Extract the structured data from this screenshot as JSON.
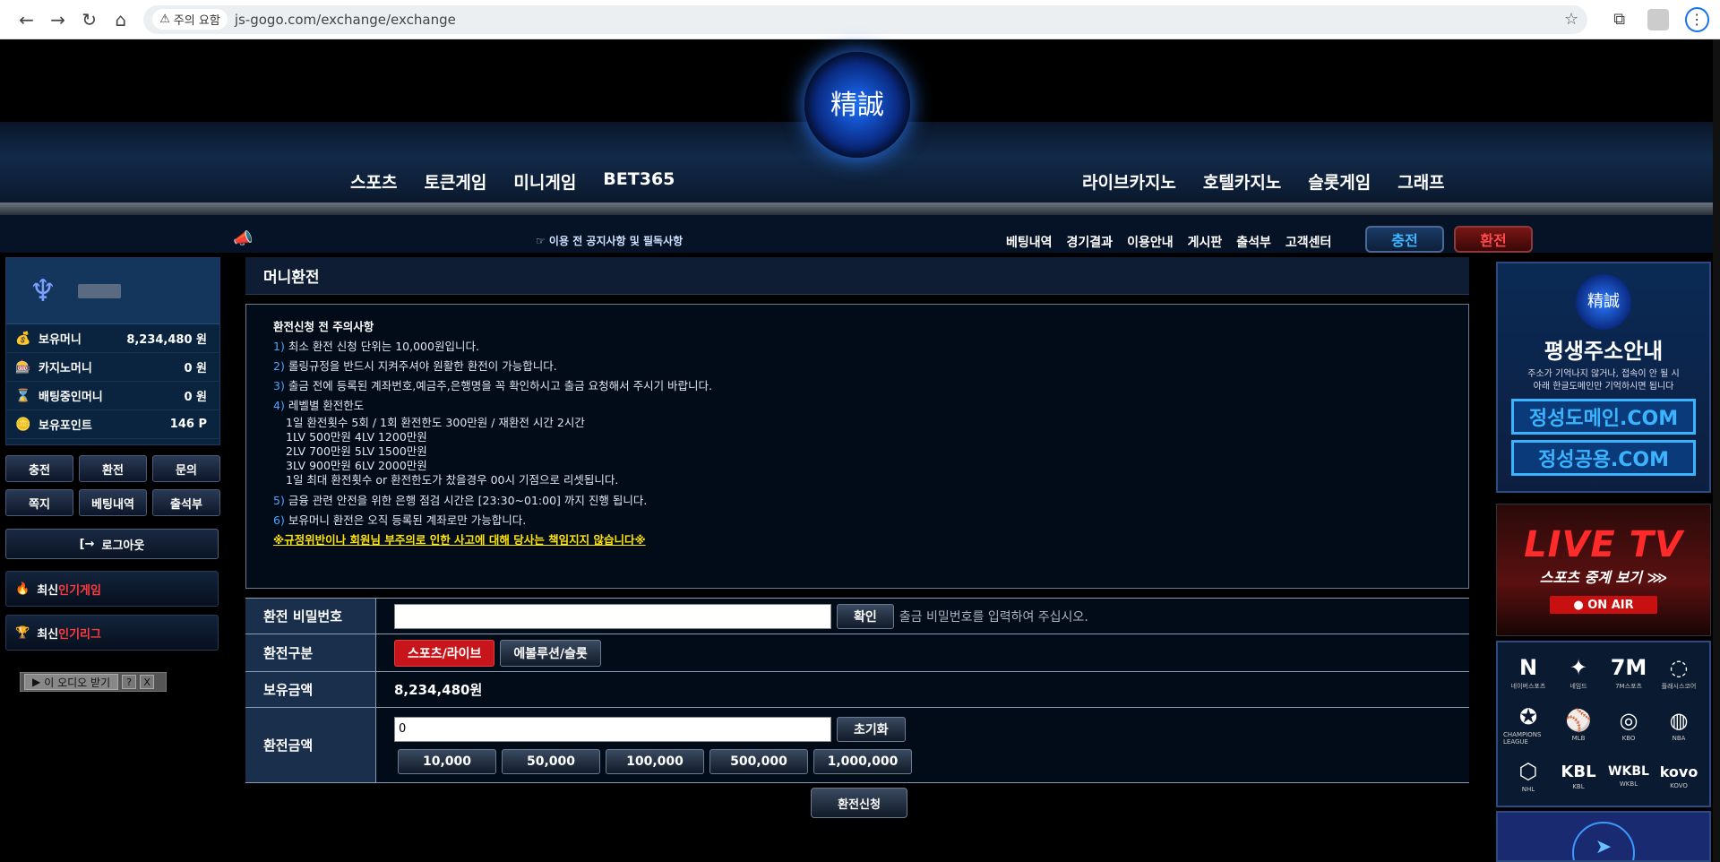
{
  "browser": {
    "warning": "주의 요함",
    "url": "js-gogo.com/exchange/exchange"
  },
  "header": {
    "logo_text": "精誠",
    "menu_left": [
      "스포츠",
      "토큰게임",
      "미니게임",
      "BET365"
    ],
    "menu_right": [
      "라이브카지노",
      "호텔카지노",
      "슬롯게임",
      "그래프"
    ],
    "notice": "☞ 이용 전 공지사항 및 필독사항",
    "top_nav": [
      "베팅내역",
      "경기결과",
      "이용안내",
      "게시판",
      "출석부",
      "고객센터"
    ],
    "charge_label": "충전",
    "exchange_label": "환전"
  },
  "user": {
    "rows": [
      {
        "label": "보유머니",
        "value": "8,234,480 원",
        "icon": "money-bag-icon"
      },
      {
        "label": "카지노머니",
        "value": "0 원",
        "icon": "chip-icon"
      },
      {
        "label": "배팅중인머니",
        "value": "0 원",
        "icon": "hourglass-icon"
      },
      {
        "label": "보유포인트",
        "value": "146 P",
        "icon": "coin-icon"
      }
    ],
    "buttons": [
      "충전",
      "환전",
      "문의",
      "쪽지",
      "베팅내역",
      "출석부"
    ],
    "logout": "로그아웃",
    "tab1": {
      "white": "최신",
      "red": "인기게임"
    },
    "tab2": {
      "white": "최신",
      "red": "인기리그"
    },
    "audio": "이 오디오 받기",
    "audio_help": "?",
    "audio_close": "X"
  },
  "main": {
    "title": "머니환전",
    "notice_head": "환전신청 전 주의사항",
    "items": [
      {
        "n": "1)",
        "text": "최소 환전 신청 단위는 10,000원입니다."
      },
      {
        "n": "2)",
        "text": "롤링규정을 반드시 지켜주셔야 원활한 환전이 가능합니다."
      },
      {
        "n": "3)",
        "text": "출금 전에 등록된 계좌번호,예금주,은행명을 꼭 확인하시고 출금 요청해서 주시기 바랍니다."
      },
      {
        "n": "4)",
        "text": "레벨별 환전한도"
      }
    ],
    "level_lines": [
      "1일 환전횟수 5회 / 1회 환전한도 300만원 / 재환전 시간 2시간",
      "1LV 500만원 4LV 1200만원",
      "2LV 700만원 5LV 1500만원",
      "3LV 900만원 6LV 2000만원",
      "1일 최대 환전횟수 or 환전한도가 찼을경우 00시 기점으로 리셋됩니다."
    ],
    "items2": [
      {
        "n": "5)",
        "text": "금융 관련 안전을 위한 은행 점검 시간은 [23:30~01:00] 까지 진행 됩니다."
      },
      {
        "n": "6)",
        "text": "보유머니 환전은 오직 등록된 계좌로만 가능합니다."
      }
    ],
    "warning": "※규정위반이나 회원님 부주의로 인한 사고에 대해 당사는 책임지지 않습니다※"
  },
  "form": {
    "pw_label": "환전 비밀번호",
    "pw_value": "",
    "confirm": "확인",
    "pw_hint": "출금 비밀번호를 입력하여 주십시오.",
    "type_label": "환전구분",
    "type_on": "스포츠/라이브",
    "type_off": "에볼루션/슬롯",
    "balance_label": "보유금액",
    "balance_value": "8,234,480원",
    "amount_label": "환전금액",
    "amount_value": "0",
    "reset": "초기화",
    "amounts": [
      "10,000",
      "50,000",
      "100,000",
      "500,000",
      "1,000,000"
    ],
    "submit": "환전신청"
  },
  "right": {
    "logo_text": "精誠",
    "title": "평생주소안내",
    "desc1": "주소가 기억나지 않거나, 접속이 안 될 시",
    "desc2": "아래 한글도메인만 기억하시면 됩니다",
    "domain1": "정성도메인.COM",
    "domain2": "정성공용.COM",
    "live": "LIVE TV",
    "live_sub": "스포츠 중계 보기 ⋙",
    "on_air": "● ON AIR",
    "sports": [
      {
        "icon": "N",
        "label": "네이버스포츠"
      },
      {
        "icon": "✦",
        "label": "네임드"
      },
      {
        "icon": "7M",
        "label": "7M스포츠"
      },
      {
        "icon": "◌",
        "label": "플래시스코어"
      },
      {
        "icon": "✪",
        "label": "CHAMPIONS LEAGUE"
      },
      {
        "icon": "⚾",
        "label": "MLB"
      },
      {
        "icon": "◎",
        "label": "KBO"
      },
      {
        "icon": "◍",
        "label": "NBA"
      },
      {
        "icon": "⬡",
        "label": "NHL"
      },
      {
        "icon": "KBL",
        "label": "KBL"
      },
      {
        "icon": "WKBL",
        "label": "WKBL"
      },
      {
        "icon": "kovo",
        "label": "KOVO"
      }
    ]
  }
}
